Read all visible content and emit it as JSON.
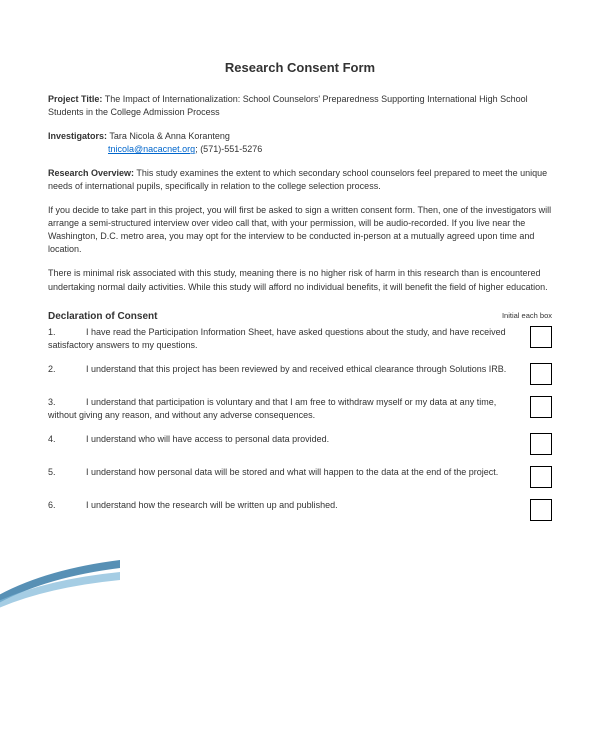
{
  "title": "Research Consent Form",
  "project": {
    "label": "Project Title:",
    "text": "The Impact of Internationalization: School Counselors' Preparedness Supporting International High School Students in the College Admission Process"
  },
  "investigators": {
    "label": "Investigators:",
    "names": "Tara Nicola & Anna Koranteng",
    "email": "tnicola@nacacnet.org",
    "phone": "; (571)-551-5276"
  },
  "overview": {
    "label": "Research Overview:",
    "text": "This study examines the extent to which secondary school counselors feel prepared to meet the unique needs of international pupils, specifically in relation to the college selection process."
  },
  "para1": "If you decide to take part in this project, you will first be asked to sign a written consent form. Then, one of the investigators will arrange a semi-structured interview over video call that, with your permission, will be audio-recorded. If you live near the Washington, D.C. metro area, you may opt for the interview to be conducted in-person at a mutually agreed upon time and location.",
  "para2": "There is minimal risk associated with this study, meaning there is no higher risk of harm in this research than is encountered undertaking normal daily activities. While this study will afford no individual benefits, it will benefit the field of higher education.",
  "declaration": {
    "heading": "Declaration of Consent",
    "initialLabel": "Initial each box"
  },
  "items": [
    {
      "num": "1.",
      "text": "I have read the Participation Information Sheet, have asked questions about the study, and have received satisfactory answers to my questions."
    },
    {
      "num": "2.",
      "text": "I understand that this project has been reviewed by and received ethical clearance through Solutions IRB."
    },
    {
      "num": "3.",
      "text": "I understand that participation is voluntary and that I am free to withdraw myself or my data at any time, without giving any reason, and without any adverse consequences."
    },
    {
      "num": "4.",
      "text": "I understand who will have access to personal data provided."
    },
    {
      "num": "5.",
      "text": "I understand how personal data will be stored and what will happen to the data at the end of the project."
    },
    {
      "num": "6.",
      "text": "I understand how the research will be written up and published."
    }
  ]
}
